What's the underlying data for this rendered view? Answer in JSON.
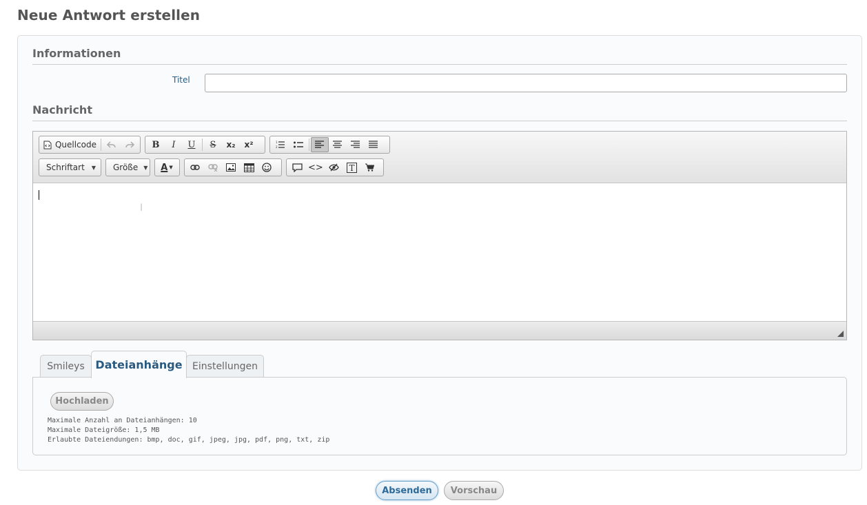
{
  "page": {
    "title": "Neue Antwort erstellen"
  },
  "informationen": {
    "heading": "Informationen",
    "title_label": "Titel",
    "title_value": "",
    "title_placeholder": ""
  },
  "nachricht": {
    "heading": "Nachricht",
    "toolbar": {
      "source_label": "Quellcode",
      "font_combo": "Schriftart",
      "size_combo": "Größe",
      "color_label": "A",
      "subscript_label": "x₂",
      "superscript_label": "x²",
      "code_label": "<>",
      "bold_label": "B",
      "italic_label": "I",
      "underline_label": "U",
      "strike_label": "S"
    }
  },
  "tabs": {
    "items": [
      {
        "label": "Smileys"
      },
      {
        "label": "Dateianhänge"
      },
      {
        "label": "Einstellungen"
      }
    ],
    "active": "Dateianhänge"
  },
  "attachments": {
    "upload_label": "Hochladen",
    "lines": [
      "Maximale Anzahl an Dateianhängen: 10",
      "Maximale Dateigröße: 1,5 MB",
      "Erlaubte Dateiendungen: bmp, doc, gif, jpeg, jpg, pdf, png, txt, zip"
    ]
  },
  "actions": {
    "submit_label": "Absenden",
    "preview_label": "Vorschau"
  },
  "colors": {
    "accent": "#2a5a80",
    "submit_border": "#6aa0c8"
  }
}
